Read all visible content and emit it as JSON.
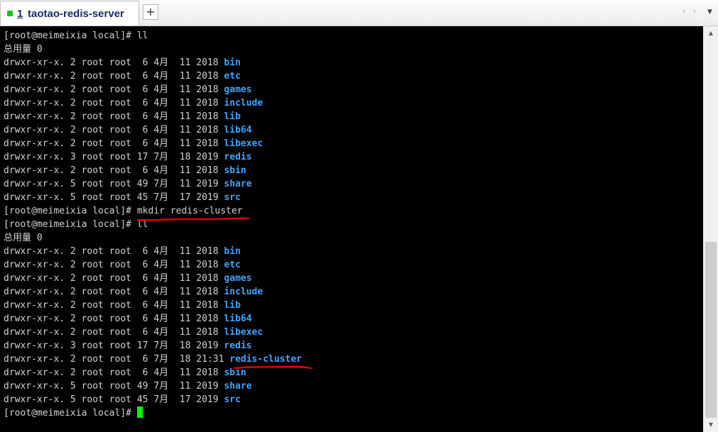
{
  "tab": {
    "number": "1",
    "title": "taotao-redis-server",
    "new_tab_label": "+"
  },
  "tab_nav": {
    "prev_icon": "‹",
    "next_icon": "›",
    "menu_icon": "▼"
  },
  "terminal": {
    "lines": [
      {
        "prompt": "[root@meimeixia local]#",
        "command": " ll"
      },
      {
        "label": "总用量 0"
      },
      {
        "perm": "drwxr-xr-x.",
        "meta": " 2 root root  6 4月  11 2018 ",
        "name": "bin"
      },
      {
        "perm": "drwxr-xr-x.",
        "meta": " 2 root root  6 4月  11 2018 ",
        "name": "etc"
      },
      {
        "perm": "drwxr-xr-x.",
        "meta": " 2 root root  6 4月  11 2018 ",
        "name": "games"
      },
      {
        "perm": "drwxr-xr-x.",
        "meta": " 2 root root  6 4月  11 2018 ",
        "name": "include"
      },
      {
        "perm": "drwxr-xr-x.",
        "meta": " 2 root root  6 4月  11 2018 ",
        "name": "lib"
      },
      {
        "perm": "drwxr-xr-x.",
        "meta": " 2 root root  6 4月  11 2018 ",
        "name": "lib64"
      },
      {
        "perm": "drwxr-xr-x.",
        "meta": " 2 root root  6 4月  11 2018 ",
        "name": "libexec"
      },
      {
        "perm": "drwxr-xr-x.",
        "meta": " 3 root root 17 7月  18 2019 ",
        "name": "redis"
      },
      {
        "perm": "drwxr-xr-x.",
        "meta": " 2 root root  6 4月  11 2018 ",
        "name": "sbin"
      },
      {
        "perm": "drwxr-xr-x.",
        "meta": " 5 root root 49 7月  11 2019 ",
        "name": "share"
      },
      {
        "perm": "drwxr-xr-x.",
        "meta": " 5 root root 45 7月  17 2019 ",
        "name": "src"
      },
      {
        "prompt": "[root@meimeixia local]#",
        "command": " mkdir redis-cluster"
      },
      {
        "prompt": "[root@meimeixia local]#",
        "command": " ll"
      },
      {
        "label": "总用量 0"
      },
      {
        "perm": "drwxr-xr-x.",
        "meta": " 2 root root  6 4月  11 2018 ",
        "name": "bin"
      },
      {
        "perm": "drwxr-xr-x.",
        "meta": " 2 root root  6 4月  11 2018 ",
        "name": "etc"
      },
      {
        "perm": "drwxr-xr-x.",
        "meta": " 2 root root  6 4月  11 2018 ",
        "name": "games"
      },
      {
        "perm": "drwxr-xr-x.",
        "meta": " 2 root root  6 4月  11 2018 ",
        "name": "include"
      },
      {
        "perm": "drwxr-xr-x.",
        "meta": " 2 root root  6 4月  11 2018 ",
        "name": "lib"
      },
      {
        "perm": "drwxr-xr-x.",
        "meta": " 2 root root  6 4月  11 2018 ",
        "name": "lib64"
      },
      {
        "perm": "drwxr-xr-x.",
        "meta": " 2 root root  6 4月  11 2018 ",
        "name": "libexec"
      },
      {
        "perm": "drwxr-xr-x.",
        "meta": " 3 root root 17 7月  18 2019 ",
        "name": "redis"
      },
      {
        "perm": "drwxr-xr-x.",
        "meta": " 2 root root  6 7月  18 21:31 ",
        "name": "redis-cluster"
      },
      {
        "perm": "drwxr-xr-x.",
        "meta": " 2 root root  6 4月  11 2018 ",
        "name": "sbin"
      },
      {
        "perm": "drwxr-xr-x.",
        "meta": " 5 root root 49 7月  11 2019 ",
        "name": "share"
      },
      {
        "perm": "drwxr-xr-x.",
        "meta": " 5 root root 45 7月  17 2019 ",
        "name": "src"
      },
      {
        "prompt": "[root@meimeixia local]#",
        "command": " ",
        "cursor": true
      }
    ]
  },
  "colors": {
    "background": "#000000",
    "text": "#d2d2d2",
    "directory": "#3fa5ff",
    "cursor": "#00ff00",
    "annotation": "#e00000",
    "tab_status": "#1fbf1f"
  },
  "scrollbar": {
    "up_icon": "▲",
    "down_icon": "▼",
    "position": 0.93
  }
}
